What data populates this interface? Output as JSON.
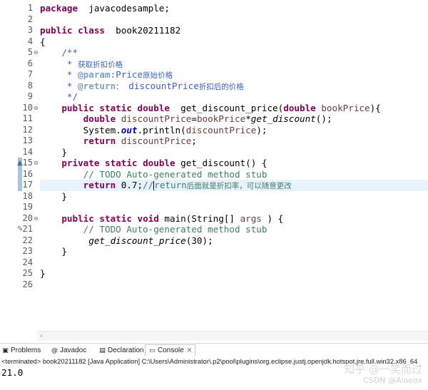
{
  "editor": {
    "lines": [
      {
        "n": "1",
        "tokens": [
          [
            "kw",
            "package"
          ],
          [
            "",
            "  javacodesample;"
          ]
        ]
      },
      {
        "n": "2",
        "tokens": []
      },
      {
        "n": "3",
        "tokens": [
          [
            "kw",
            "public class"
          ],
          [
            "",
            "  book20211182"
          ]
        ]
      },
      {
        "n": "4",
        "tokens": [
          [
            "",
            "{"
          ]
        ]
      },
      {
        "n": "5",
        "tokens": [
          [
            "cmt",
            "    /**"
          ]
        ]
      },
      {
        "n": "6",
        "tokens": [
          [
            "cmt",
            "     * "
          ],
          [
            "cmt cjk",
            "获取折扣价格"
          ]
        ]
      },
      {
        "n": "7",
        "tokens": [
          [
            "cmt",
            "     * "
          ],
          [
            "tag",
            "@param"
          ],
          [
            "cmt",
            ":Price"
          ],
          [
            "cmt cjk",
            "原始价格"
          ]
        ]
      },
      {
        "n": "8",
        "tokens": [
          [
            "cmt",
            "     * "
          ],
          [
            "tag",
            "@return"
          ],
          [
            "cmt cjk",
            "："
          ],
          [
            "cmt",
            " discountPrice"
          ],
          [
            "cmt cjk",
            "折扣后的价格"
          ]
        ]
      },
      {
        "n": "9",
        "tokens": [
          [
            "cmt",
            "     */"
          ]
        ]
      },
      {
        "n": "10",
        "tokens": [
          [
            "",
            "    "
          ],
          [
            "kw",
            "public static double"
          ],
          [
            "",
            "  get_discount_price("
          ],
          [
            "kw",
            "double"
          ],
          [
            "",
            " "
          ],
          [
            "var",
            "bookPrice"
          ],
          [
            "",
            "){"
          ]
        ]
      },
      {
        "n": "11",
        "tokens": [
          [
            "",
            "        "
          ],
          [
            "kw",
            "double"
          ],
          [
            "",
            " "
          ],
          [
            "var",
            "discountPrice"
          ],
          [
            "",
            "="
          ],
          [
            "var",
            "bookPrice"
          ],
          [
            "",
            "*"
          ],
          [
            "ital",
            "get_discount"
          ],
          [
            "",
            "();"
          ]
        ]
      },
      {
        "n": "12",
        "tokens": [
          [
            "",
            "        System."
          ],
          [
            "fld",
            "out"
          ],
          [
            "",
            ".println("
          ],
          [
            "var",
            "discountPrice"
          ],
          [
            "",
            ");"
          ]
        ]
      },
      {
        "n": "13",
        "tokens": [
          [
            "",
            "        "
          ],
          [
            "kw",
            "return"
          ],
          [
            "",
            " "
          ],
          [
            "var",
            "discountPrice"
          ],
          [
            "",
            ";"
          ]
        ]
      },
      {
        "n": "14",
        "tokens": [
          [
            "",
            "    }"
          ]
        ]
      },
      {
        "n": "15",
        "tokens": [
          [
            "",
            "    "
          ],
          [
            "kw",
            "private static double"
          ],
          [
            "",
            " get_discount() {"
          ]
        ]
      },
      {
        "n": "16",
        "tokens": [
          [
            "lcmt",
            "        // TODO Auto-generated method stub"
          ]
        ]
      },
      {
        "n": "17",
        "tokens": [
          [
            "",
            "        "
          ],
          [
            "kw",
            "return"
          ],
          [
            "",
            " 0.7;"
          ],
          [
            "lcmt",
            "//"
          ],
          [
            "caret",
            ""
          ],
          [
            "lcmt",
            "return"
          ],
          [
            "lcmt cjk",
            "后面就是折扣率，可以随意更改"
          ]
        ]
      },
      {
        "n": "18",
        "tokens": [
          [
            "",
            "    }"
          ]
        ]
      },
      {
        "n": "19",
        "tokens": []
      },
      {
        "n": "20",
        "tokens": [
          [
            "",
            "    "
          ],
          [
            "kw",
            "public static void"
          ],
          [
            "",
            " main(String[] "
          ],
          [
            "var",
            "args"
          ],
          [
            "",
            " ) {"
          ]
        ]
      },
      {
        "n": "21",
        "tokens": [
          [
            "lcmt",
            "        // TODO Auto-generated method stub"
          ]
        ]
      },
      {
        "n": "22",
        "tokens": [
          [
            "",
            "         "
          ],
          [
            "ital",
            "get_discount_price"
          ],
          [
            "",
            "(30);"
          ]
        ]
      },
      {
        "n": "23",
        "tokens": [
          [
            "",
            "    }"
          ]
        ]
      },
      {
        "n": "24",
        "tokens": []
      },
      {
        "n": "25",
        "tokens": [
          [
            "",
            "}"
          ]
        ]
      },
      {
        "n": "26",
        "tokens": []
      }
    ],
    "current_line": "17",
    "fold_lines": [
      "5",
      "10",
      "15",
      "20"
    ],
    "marker_lines": [
      "15",
      "16",
      "17"
    ],
    "gutter_icons": {
      "15": "override-icon",
      "21": "task-icon"
    }
  },
  "views": {
    "tabs": [
      {
        "label": "Problems",
        "icon": "problems-icon",
        "glyph": "▣"
      },
      {
        "label": "Javadoc",
        "icon": "javadoc-icon",
        "glyph": "@"
      },
      {
        "label": "Declaration",
        "icon": "declaration-icon",
        "glyph": "▤"
      },
      {
        "label": "Console",
        "icon": "console-icon",
        "glyph": "▭",
        "active": true,
        "close": "✕"
      }
    ],
    "console_status": "<terminated> book20211182 [Java Application] C:\\Users\\Administrator\\.p2\\pool\\plugins\\org.eclipse.justj.openjdk.hotspot.jre.full.win32.x86_64",
    "console_output": "21.0"
  },
  "watermark": {
    "line1": "知乎 @一笑而过",
    "line2": "CSDN @Aloeox"
  },
  "colors": {
    "keyword": "#7f0055",
    "javadoc": "#3f5fbf",
    "line_comment": "#3f7f5f",
    "variable": "#6a3e3e",
    "current_line_bg": "#e8f2fe"
  }
}
